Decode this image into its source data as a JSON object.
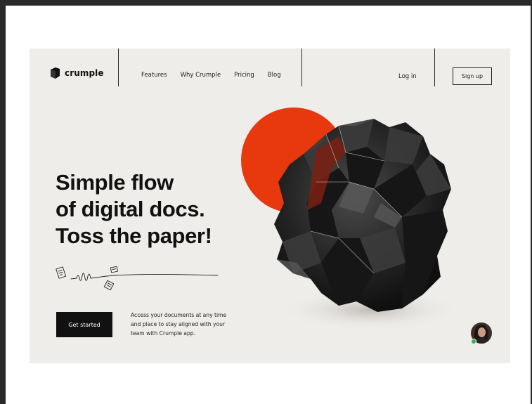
{
  "brand": {
    "name": "crumple",
    "logo_icon": "folded-paper-icon"
  },
  "nav": {
    "items": [
      {
        "label": "Features"
      },
      {
        "label": "Why Crumple"
      },
      {
        "label": "Pricing"
      },
      {
        "label": "Blog"
      }
    ],
    "login_label": "Log in",
    "signup_label": "Sign up"
  },
  "hero": {
    "headline": [
      "Simple flow",
      "of digital docs.",
      "Toss the paper!"
    ],
    "cta_label": "Get started",
    "description": "Access your documents at any time and place to stay aligned with your team with Crumple app."
  },
  "colors": {
    "background": "#efedea",
    "accent": "#e8380d",
    "dark": "#111111",
    "online": "#2fb35b"
  },
  "illustration": {
    "name": "crumpled-paper-ball",
    "circle": "red-circle"
  },
  "chat": {
    "avatar": "support-avatar",
    "status": "online"
  }
}
